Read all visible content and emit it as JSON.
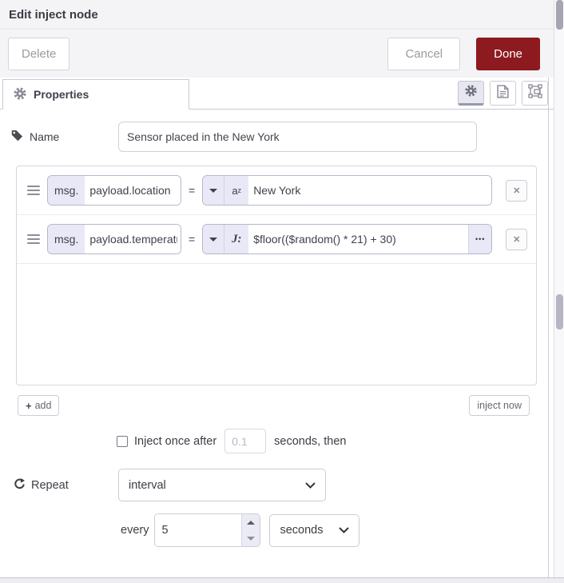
{
  "dialog": {
    "title": "Edit inject node"
  },
  "toolbar": {
    "delete": "Delete",
    "cancel": "Cancel",
    "done": "Done"
  },
  "tabs": {
    "properties": "Properties"
  },
  "name_row": {
    "label": "Name",
    "value": "Sensor placed in the New York"
  },
  "props": {
    "rows": [
      {
        "prefix": "msg.",
        "key": "payload.location",
        "equals": "=",
        "type": "string",
        "value": "New York"
      },
      {
        "prefix": "msg.",
        "key": "payload.temperature",
        "equals": "=",
        "type": "expression",
        "value": "$floor(($random() * 21) + 30)"
      }
    ],
    "add": "add",
    "inject_now": "inject now"
  },
  "once": {
    "label": "Inject once after",
    "delay": "0.1",
    "suffix": "seconds, then"
  },
  "repeat": {
    "label": "Repeat",
    "value": "interval"
  },
  "every": {
    "label": "every",
    "value": "5",
    "unit": "seconds"
  },
  "icons": {
    "plus": "+",
    "close": "✕",
    "ellipsis": "•••",
    "string_type_a": "a",
    "string_type_z": "z",
    "expression_type": "J:"
  },
  "colors": {
    "accent": "#e8e8f6",
    "done_bg": "#8c1a1f",
    "tab_underline": "#9898aa"
  }
}
